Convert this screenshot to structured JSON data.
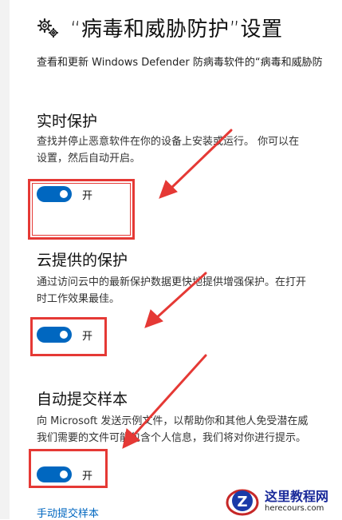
{
  "header": {
    "icon": "gear-icon",
    "title": "“病毒和威胁防护”设置",
    "subtitle": "查看和更新 Windows Defender 防病毒软件的“病毒和威胁防"
  },
  "sections": [
    {
      "heading": "实时保护",
      "desc": [
        "查找并停止恶意软件在你的设备上安装或运行。 你可以在",
        "设置，然后自动开启。"
      ],
      "toggle_label": "开",
      "toggle_on": true
    },
    {
      "heading": "云提供的保护",
      "desc": [
        "通过访问云中的最新保护数据更快地提供增强保护。在打开",
        "时工作效果最佳。"
      ],
      "toggle_label": "开",
      "toggle_on": true
    },
    {
      "heading": "自动提交样本",
      "desc": [
        "向 Microsoft 发送示例文件，以帮助你和其他人免受潜在威",
        "我们需要的文件可能包含个人信息，我们将对你进行提示。"
      ],
      "toggle_label": "开",
      "toggle_on": true
    }
  ],
  "manual_submit_link": "手动提交样本",
  "watermark": {
    "name": "这里教程网",
    "url": "herecours.com"
  },
  "colors": {
    "accent": "#0067c0",
    "annotation": "#e53935"
  }
}
